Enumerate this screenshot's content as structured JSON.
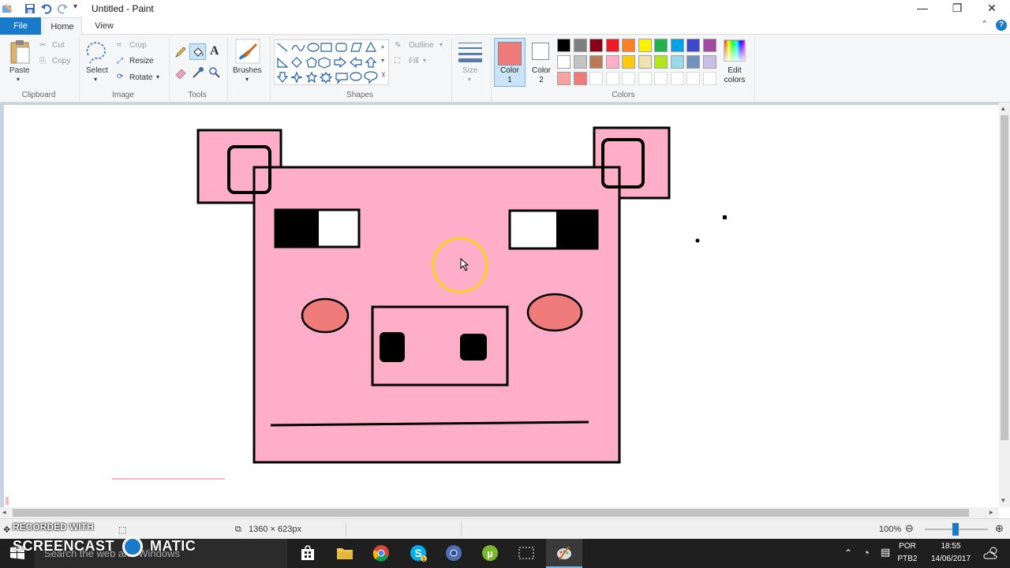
{
  "window": {
    "title": "Untitled - Paint",
    "minimize": "—",
    "restore": "❐",
    "close": "✕"
  },
  "tabs": {
    "file": "File",
    "home": "Home",
    "view": "View"
  },
  "ribbon": {
    "clipboard": {
      "label": "Clipboard",
      "paste": "Paste",
      "cut": "Cut",
      "copy": "Copy"
    },
    "image": {
      "label": "Image",
      "select": "Select",
      "crop": "Crop",
      "resize": "Resize",
      "rotate": "Rotate"
    },
    "tools": {
      "label": "Tools"
    },
    "brushes": {
      "label": "Brushes"
    },
    "shapes": {
      "label": "Shapes",
      "outline": "Outline",
      "fill": "Fill"
    },
    "size": {
      "label": "Size"
    },
    "colors": {
      "label": "Colors",
      "color1": "Color 1",
      "color1_value": "#f07b7b",
      "color2": "Color 2",
      "color2_value": "#ffffff",
      "edit": "Edit colors",
      "palette_row1": [
        "#000000",
        "#7f7f7f",
        "#880015",
        "#ed1c24",
        "#ff7f27",
        "#fff200",
        "#22b14c",
        "#00a2e8",
        "#3f48cc",
        "#a349a4"
      ],
      "palette_row2": [
        "#ffffff",
        "#c3c3c3",
        "#b97a57",
        "#ffaec9",
        "#ffc90e",
        "#efe4b0",
        "#b5e61d",
        "#99d9ea",
        "#7092be",
        "#c8bfe7"
      ],
      "palette_row3": [
        "#f7a1a1",
        "#f07b7b"
      ]
    }
  },
  "status": {
    "dimensions": "1360 × 623px",
    "zoom": "100%"
  },
  "taskbar": {
    "search_placeholder": "Search the web and Windows",
    "language": "POR",
    "layout": "PTB2",
    "time": "18:55",
    "date": "14/06/2017"
  },
  "watermark": {
    "line1": "RECORDED WITH",
    "line2": "SCREENCAST",
    "line3": "MATIC"
  },
  "drawing": {
    "pig_pink": "#ffaec9",
    "cheek_color": "#f07b7b"
  }
}
